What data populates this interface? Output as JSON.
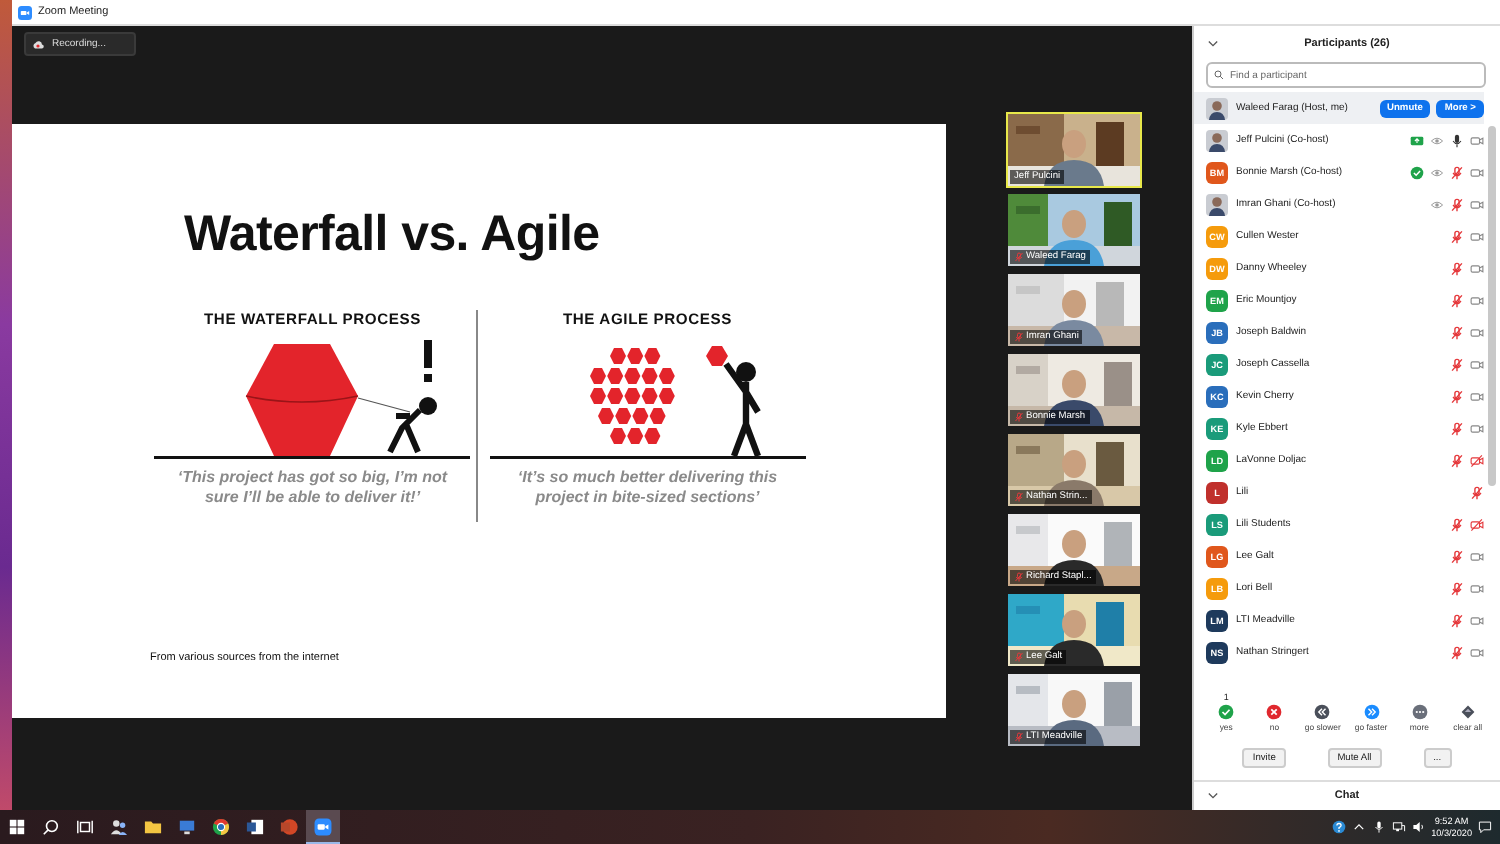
{
  "window": {
    "title": "Zoom Meeting"
  },
  "recording": {
    "label": "Recording..."
  },
  "slide": {
    "title": "Waterfall vs. Agile",
    "panels": [
      {
        "kind": "waterfall",
        "heading": "THE WATERFALL PROCESS",
        "quote": "‘This project has got so big, I’m not sure I’ll be able to deliver it!’"
      },
      {
        "kind": "agile",
        "heading": "THE AGILE PROCESS",
        "quote": "‘It’s so much better delivering this project in bite-sized sections’"
      }
    ],
    "footer": "From various sources from the internet"
  },
  "videos": [
    {
      "name": "Jeff Pulcini",
      "speaking": true,
      "muted": false
    },
    {
      "name": "Waleed Farag",
      "speaking": false,
      "muted": true
    },
    {
      "name": "Imran Ghani",
      "speaking": false,
      "muted": true
    },
    {
      "name": "Bonnie Marsh",
      "speaking": false,
      "muted": true
    },
    {
      "name": "Nathan Strin...",
      "speaking": false,
      "muted": true
    },
    {
      "name": "Richard Stapl...",
      "speaking": false,
      "muted": true
    },
    {
      "name": "Lee Galt",
      "speaking": false,
      "muted": true
    },
    {
      "name": "LTI Meadville",
      "speaking": false,
      "muted": true
    }
  ],
  "participants": {
    "title": "Participants (26)",
    "search": {
      "placeholder": "Find a participant"
    },
    "rows": [
      {
        "name": "Waleed Farag (Host, me)",
        "highlighted": true,
        "actions": [
          "Unmute",
          "More >"
        ]
      },
      {
        "name": "Jeff Pulcini (Co-host)",
        "highlighted": false,
        "icons": [
          {
            "kind": "share"
          },
          {
            "kind": "eye"
          },
          {
            "kind": "mic"
          },
          {
            "kind": "video"
          }
        ]
      },
      {
        "kind": "initials",
        "name": "Bonnie Marsh (Co-host)",
        "initials": "BM",
        "color": "#e0571c",
        "highlighted": false,
        "icons": [
          {
            "kind": "check"
          },
          {
            "kind": "eye"
          },
          {
            "kind": "mic_muted"
          },
          {
            "kind": "video"
          }
        ]
      },
      {
        "name": "Imran Ghani (Co-host)",
        "highlighted": false,
        "icons": [
          {
            "kind": "eye"
          },
          {
            "kind": "mic_muted"
          },
          {
            "kind": "video"
          }
        ]
      },
      {
        "kind": "initials",
        "name": "Cullen Wester",
        "initials": "CW",
        "color": "#f59b0c",
        "highlighted": false,
        "icons": [
          {
            "kind": "mic_muted"
          },
          {
            "kind": "video"
          }
        ]
      },
      {
        "kind": "initials",
        "name": "Danny Wheeley",
        "initials": "DW",
        "color": "#f59b0c",
        "highlighted": false,
        "icons": [
          {
            "kind": "mic_muted"
          },
          {
            "kind": "video"
          }
        ]
      },
      {
        "kind": "initials",
        "name": "Eric Mountjoy",
        "initials": "EM",
        "color": "#1fa34a",
        "highlighted": false,
        "icons": [
          {
            "kind": "mic_muted"
          },
          {
            "kind": "video"
          }
        ]
      },
      {
        "kind": "initials",
        "name": "Joseph Baldwin",
        "initials": "JB",
        "color": "#2a6ebb",
        "highlighted": false,
        "icons": [
          {
            "kind": "mic_muted"
          },
          {
            "kind": "video"
          }
        ]
      },
      {
        "kind": "initials",
        "name": "Joseph Cassella",
        "initials": "JC",
        "color": "#1a9b7a",
        "highlighted": false,
        "icons": [
          {
            "kind": "mic_muted"
          },
          {
            "kind": "video"
          }
        ]
      },
      {
        "kind": "initials",
        "name": "Kevin Cherry",
        "initials": "KC",
        "color": "#2a6ebb",
        "highlighted": false,
        "icons": [
          {
            "kind": "mic_muted"
          },
          {
            "kind": "video"
          }
        ]
      },
      {
        "kind": "initials",
        "name": "Kyle Ebbert",
        "initials": "KE",
        "color": "#1a9b7a",
        "highlighted": false,
        "icons": [
          {
            "kind": "mic_muted"
          },
          {
            "kind": "video"
          }
        ]
      },
      {
        "kind": "initials",
        "name": "LaVonne Doljac",
        "initials": "LD",
        "color": "#1fa34a",
        "highlighted": false,
        "icons": [
          {
            "kind": "mic_muted"
          },
          {
            "kind": "video_off"
          }
        ]
      },
      {
        "kind": "initials",
        "name": "Lili",
        "initials": "L",
        "color": "#c0302c",
        "highlighted": false,
        "icons": [
          {
            "kind": "mic_muted"
          }
        ]
      },
      {
        "kind": "initials",
        "name": "Lili Students",
        "initials": "LS",
        "color": "#1a9b7a",
        "highlighted": false,
        "icons": [
          {
            "kind": "mic_muted"
          },
          {
            "kind": "video_off"
          }
        ]
      },
      {
        "kind": "initials",
        "name": "Lee Galt",
        "initials": "LG",
        "color": "#e0571c",
        "highlighted": false,
        "icons": [
          {
            "kind": "mic_muted"
          },
          {
            "kind": "video"
          }
        ]
      },
      {
        "kind": "initials",
        "name": "Lori Bell",
        "initials": "LB",
        "color": "#f59b0c",
        "highlighted": false,
        "icons": [
          {
            "kind": "mic_muted"
          },
          {
            "kind": "video"
          }
        ]
      },
      {
        "kind": "initials",
        "name": "LTI Meadville",
        "initials": "LM",
        "color": "#1e3a5c",
        "highlighted": false,
        "icons": [
          {
            "kind": "mic_muted"
          },
          {
            "kind": "video"
          }
        ]
      },
      {
        "kind": "initials",
        "name": "Nathan Stringert",
        "initials": "NS",
        "color": "#1e3a5c",
        "highlighted": false,
        "icons": [
          {
            "kind": "mic_muted"
          },
          {
            "kind": "video"
          }
        ]
      }
    ],
    "reactions": [
      {
        "kind": "yes",
        "label": "yes",
        "count": "1"
      },
      {
        "kind": "no",
        "label": "no"
      },
      {
        "kind": "slower",
        "label": "go slower"
      },
      {
        "kind": "faster",
        "label": "go faster"
      },
      {
        "kind": "more",
        "label": "more"
      },
      {
        "kind": "clear",
        "label": "clear all"
      }
    ],
    "buttons": [
      "Invite",
      "Mute All",
      "..."
    ],
    "chat": {
      "title": "Chat"
    }
  },
  "taskbar": {
    "apps": [
      {
        "kind": "people",
        "active": false
      },
      {
        "kind": "folder",
        "active": false
      },
      {
        "kind": "monitor",
        "active": false
      },
      {
        "kind": "browser",
        "active": false
      },
      {
        "kind": "document",
        "active": false
      },
      {
        "kind": "presentation",
        "active": false
      },
      {
        "kind": "camera",
        "active": true
      }
    ],
    "time": "9:52 AM",
    "date": "10/3/2020"
  }
}
